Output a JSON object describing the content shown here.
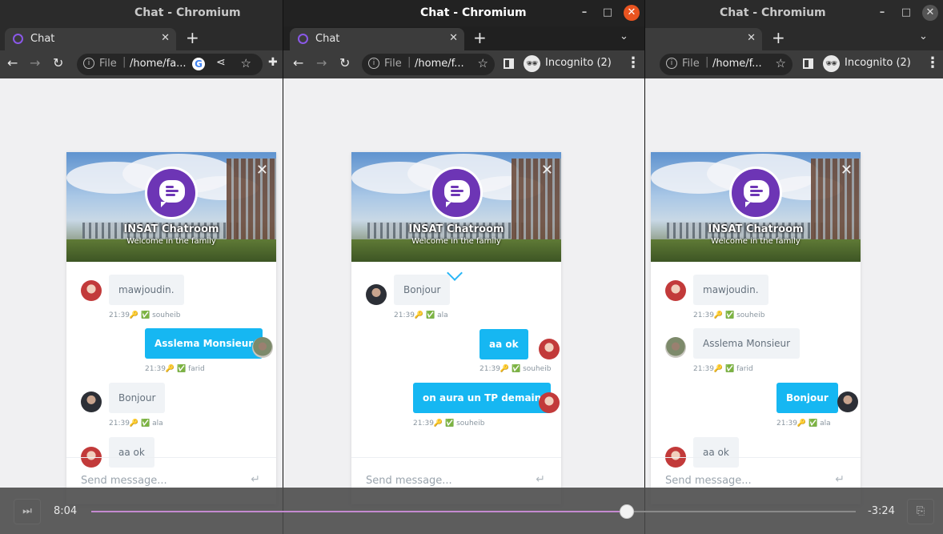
{
  "app_title": "Chat - Chromium",
  "tab_label": "Chat",
  "new_tab": "+",
  "window_controls": {
    "minimize": "–",
    "maximize": "□",
    "close": "✕"
  },
  "omnibox": {
    "scheme": "File",
    "path": "/home/fa...",
    "path_short": "/home/f..."
  },
  "incognito_label": "Incognito (2)",
  "chat": {
    "room_title": "INSAT Chatroom",
    "room_subtitle": "Welcome in the family",
    "input_placeholder": "Send message...",
    "enter_icon": "↵"
  },
  "windows": [
    {
      "name": "left",
      "messages": [
        {
          "text": "mawjoudin.",
          "dir": "in",
          "avatar": "red"
        },
        {
          "meta": "21:39🔑 ✅ souheib"
        },
        {
          "text": "Asslema Monsieur",
          "dir": "out",
          "avatar": "photo"
        },
        {
          "meta": "21:39🔑 ✅ farid"
        },
        {
          "text": "Bonjour",
          "dir": "in",
          "avatar": "dark"
        },
        {
          "meta": "21:39🔑 ✅ ala"
        },
        {
          "text": "aa ok",
          "dir": "in",
          "avatar": "red"
        }
      ]
    },
    {
      "name": "middle",
      "messages": [
        {
          "text": "Bonjour",
          "dir": "in",
          "avatar": "dark"
        },
        {
          "meta": "21:39🔑 ✅ ala"
        },
        {
          "text": "aa ok",
          "dir": "out",
          "avatar": "red"
        },
        {
          "meta": "21:39🔑 ✅ souheib"
        },
        {
          "text": "on aura un TP demain",
          "dir": "out",
          "avatar": "red"
        },
        {
          "meta": "21:39🔑 ✅ souheib"
        }
      ]
    },
    {
      "name": "right",
      "messages": [
        {
          "text": "mawjoudin.",
          "dir": "in",
          "avatar": "red"
        },
        {
          "meta": "21:39🔑 ✅ souheib"
        },
        {
          "text": "Asslema Monsieur",
          "dir": "in",
          "avatar": "photo"
        },
        {
          "meta": "21:39🔑 ✅ farid"
        },
        {
          "text": "Bonjour",
          "dir": "out",
          "avatar": "dark"
        },
        {
          "meta": "21:39🔑 ✅ ala"
        },
        {
          "text": "aa ok",
          "dir": "in",
          "avatar": "red"
        }
      ]
    }
  ],
  "player": {
    "elapsed": "8:04",
    "remaining": "-3:24",
    "progress_fraction": 0.701,
    "skip_icon": "⏭",
    "playlist_icon": "⎘"
  },
  "colors": {
    "accent": "#16b7f2",
    "logo": "#6d35b5",
    "close_active": "#e95420"
  }
}
